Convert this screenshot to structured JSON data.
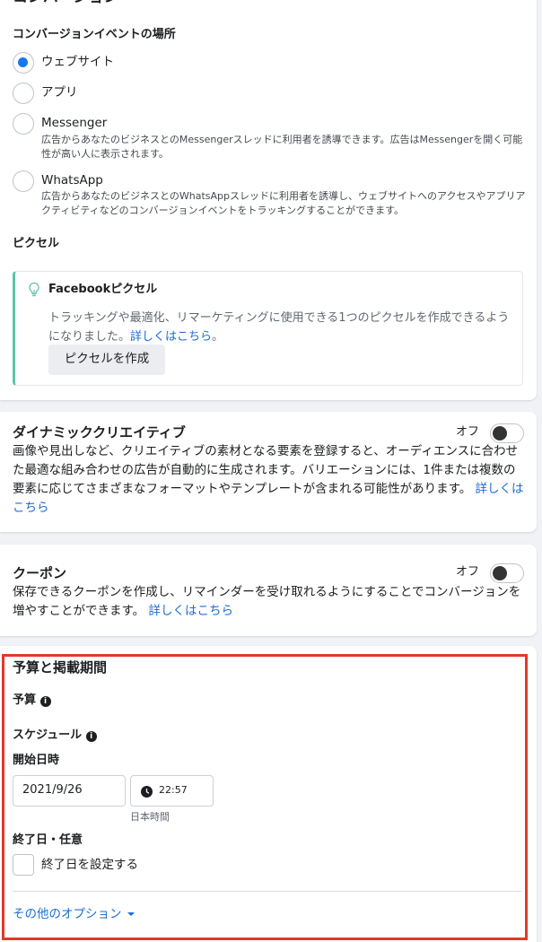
{
  "conversion": {
    "title": "コンバージョン",
    "location_label": "コンバージョンイベントの場所",
    "options": [
      {
        "label": "ウェブサイト",
        "desc": "",
        "checked": true
      },
      {
        "label": "アプリ",
        "desc": "",
        "checked": false
      },
      {
        "label": "Messenger",
        "desc": "広告からあなたのビジネスとのMessengerスレッドに利用者を誘導できます。広告はMessengerを開く可能性が高い人に表示されます。",
        "checked": false
      },
      {
        "label": "WhatsApp",
        "desc": "広告からあなたのビジネスとのWhatsAppスレッドに利用者を誘導し、ウェブサイトへのアクセスやアプリアクティビティなどのコンバージョンイベントをトラッキングすることができます。",
        "checked": false
      }
    ],
    "pixel_label": "ピクセル",
    "pixel_box": {
      "title": "Facebookピクセル",
      "desc": "トラッキングや最適化、リマーケティングに使用できる1つのピクセルを作成できるようになりました。",
      "link": "詳しくはこちら",
      "period": "。",
      "button": "ピクセルを作成"
    }
  },
  "dynamic_creative": {
    "title": "ダイナミッククリエイティブ",
    "toggle_label": "オフ",
    "desc": "画像や見出しなど、クリエイティブの素材となる要素を登録すると、オーディエンスに合わせた最適な組み合わせの広告が自動的に生成されます。バリエーションには、1件または複数の要素に応じてさまざまなフォーマットやテンプレートが含まれる可能性があります。",
    "link": "詳しくはこちら"
  },
  "coupon": {
    "title": "クーポン",
    "toggle_label": "オフ",
    "desc": "保存できるクーポンを作成し、リマインダーを受け取れるようにすることでコンバージョンを増やすことができます。",
    "link": "詳しくはこちら"
  },
  "budget": {
    "title": "予算と掲載期間",
    "budget_label": "予算",
    "schedule_label": "スケジュール",
    "start_label": "開始日時",
    "start_date": "2021/9/26",
    "start_time": "22:57",
    "timezone": "日本時間",
    "end_label": "終了日・任意",
    "end_checkbox": "終了日を設定する",
    "more_options": "その他のオプション"
  },
  "colors": {
    "accent": "#1877f2",
    "link": "#1b6dd0",
    "highlight": "#e4382a",
    "pixel_bar": "#5ec4a8"
  }
}
